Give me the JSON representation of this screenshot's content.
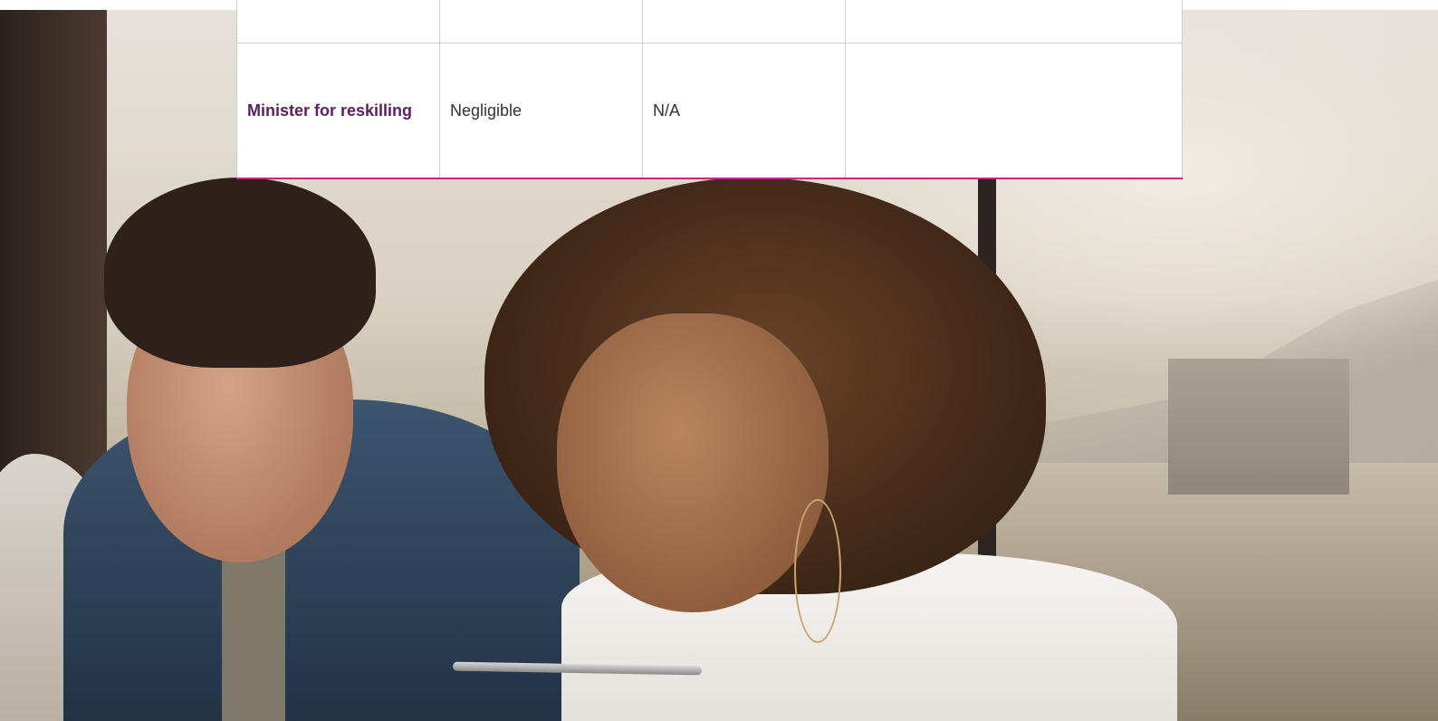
{
  "table": {
    "rows": [
      {
        "label": "",
        "col2": "",
        "col3": "",
        "col4": ""
      },
      {
        "label": "Minister for reskilling",
        "col2": "Negligible",
        "col3": "N/A",
        "col4": ""
      }
    ]
  },
  "colors": {
    "label_text": "#5b1f5e",
    "accent_rule": "#c8248a",
    "grid_line": "#cfcfcf"
  }
}
